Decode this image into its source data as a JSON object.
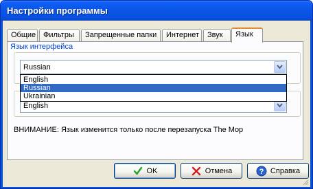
{
  "window": {
    "title": "Настройки программы"
  },
  "tabs": [
    {
      "label": "Общие"
    },
    {
      "label": "Фильтры"
    },
    {
      "label": "Запрещенные папки"
    },
    {
      "label": "Интернет"
    },
    {
      "label": "Звук"
    },
    {
      "label": "Язык",
      "active": true
    }
  ],
  "language_group": {
    "legend": "Язык интерфейса",
    "selected": "Russian",
    "options": [
      "English",
      "Russian",
      "Ukrainian"
    ]
  },
  "second_combo": {
    "value": "English"
  },
  "notice": "ВНИМАНИЕ: Язык изменится только после перезапуска The Mop",
  "buttons": {
    "ok": "OK",
    "cancel": "Отмена",
    "help": "Справка"
  },
  "colors": {
    "titlebar": "#0a55e6",
    "legend_text": "#0046d5",
    "selection": "#316ac5",
    "active_tab_accent": "#e68b2c"
  },
  "icons": {
    "ok": "check-icon",
    "cancel": "x-icon",
    "help": "help-icon",
    "dropdown": "chevron-down-icon"
  }
}
